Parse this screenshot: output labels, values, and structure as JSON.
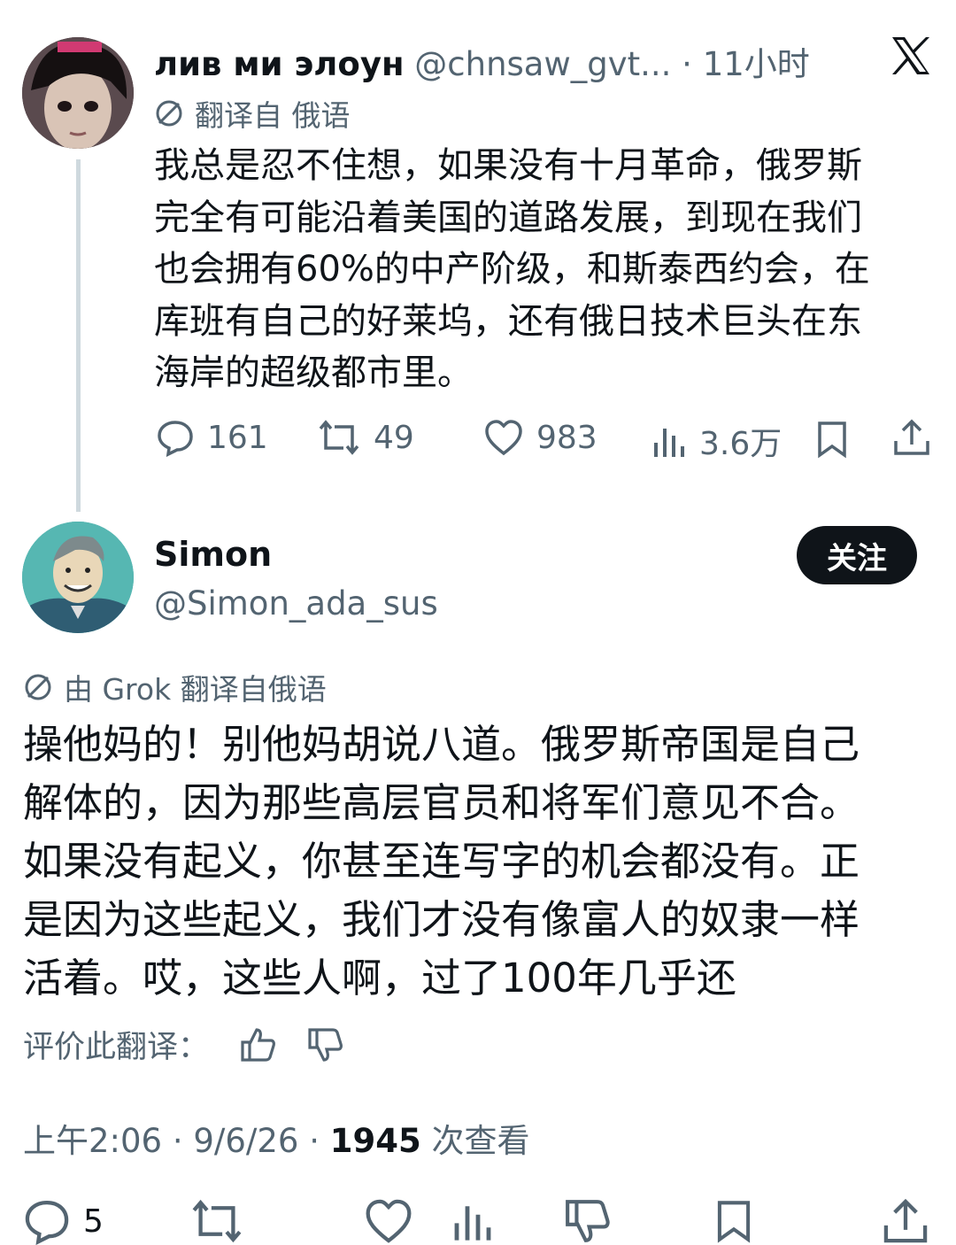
{
  "original_tweet": {
    "display_name": "лив ми элоун",
    "handle_time": "@chnsaw_gvt... · 11小时",
    "translated_label": "翻译自 俄语",
    "lines": [
      "我总是忍不住想，如果没有十月革命，俄罗斯",
      "完全有可能沿着美国的道路发展，到现在我们",
      "也会拥有60%的中产阶级，和斯泰西约会，在",
      "库班有自己的好莱坞，还有俄日技术巨头在东",
      "海岸的超级都市里。"
    ],
    "stats": {
      "replies": "161",
      "retweets": "49",
      "likes": "983",
      "views": "3.6万"
    },
    "icons": [
      "x-logo-icon",
      "globe-icon",
      "reply-icon",
      "retweet-icon",
      "like-icon",
      "views-icon",
      "bookmark-icon",
      "share-icon"
    ]
  },
  "reply_tweet": {
    "display_name": "Simon",
    "handle": "@Simon_ada_sus",
    "follow_label": "关注",
    "translated_label": "由 Grok 翻译自俄语",
    "lines": [
      "操他妈的！别他妈胡说八道。俄罗斯帝国是自己",
      "解体的，因为那些高层官员和将军们意见不合。",
      "如果没有起义，你甚至连写字的机会都没有。正",
      "是因为这些起义，我们才没有像富人的奴隶一样",
      "活着。哎，这些人啊，过了100年几乎还"
    ],
    "rate_label": "评价此翻译：",
    "timestamp": "上午2:06 · 9/6/26 · ",
    "views_count": "1945",
    "views_label": " 次查看",
    "reply_count": "5"
  },
  "colors": {
    "text": "#0f1419",
    "muted": "#536471",
    "thread_line": "#cfd9de",
    "button": "#0f1419"
  }
}
